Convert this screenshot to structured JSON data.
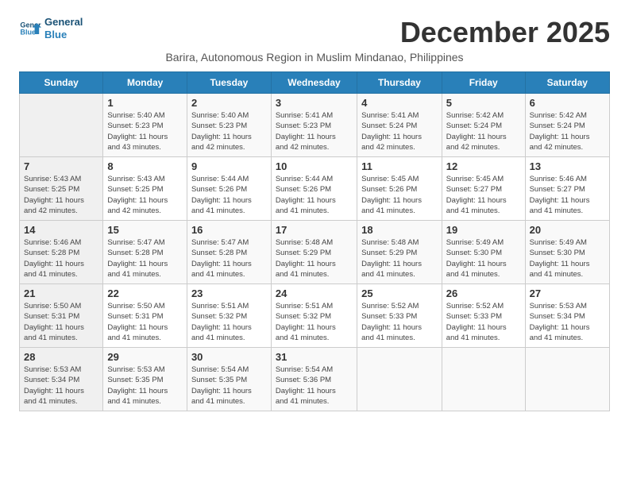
{
  "header": {
    "logo_line1": "General",
    "logo_line2": "Blue",
    "month_title": "December 2025",
    "subtitle": "Barira, Autonomous Region in Muslim Mindanao, Philippines"
  },
  "weekdays": [
    "Sunday",
    "Monday",
    "Tuesday",
    "Wednesday",
    "Thursday",
    "Friday",
    "Saturday"
  ],
  "weeks": [
    [
      {
        "day": "",
        "info": ""
      },
      {
        "day": "1",
        "info": "Sunrise: 5:40 AM\nSunset: 5:23 PM\nDaylight: 11 hours\nand 43 minutes."
      },
      {
        "day": "2",
        "info": "Sunrise: 5:40 AM\nSunset: 5:23 PM\nDaylight: 11 hours\nand 42 minutes."
      },
      {
        "day": "3",
        "info": "Sunrise: 5:41 AM\nSunset: 5:23 PM\nDaylight: 11 hours\nand 42 minutes."
      },
      {
        "day": "4",
        "info": "Sunrise: 5:41 AM\nSunset: 5:24 PM\nDaylight: 11 hours\nand 42 minutes."
      },
      {
        "day": "5",
        "info": "Sunrise: 5:42 AM\nSunset: 5:24 PM\nDaylight: 11 hours\nand 42 minutes."
      },
      {
        "day": "6",
        "info": "Sunrise: 5:42 AM\nSunset: 5:24 PM\nDaylight: 11 hours\nand 42 minutes."
      }
    ],
    [
      {
        "day": "7",
        "info": "Sunrise: 5:43 AM\nSunset: 5:25 PM\nDaylight: 11 hours\nand 42 minutes."
      },
      {
        "day": "8",
        "info": "Sunrise: 5:43 AM\nSunset: 5:25 PM\nDaylight: 11 hours\nand 42 minutes."
      },
      {
        "day": "9",
        "info": "Sunrise: 5:44 AM\nSunset: 5:26 PM\nDaylight: 11 hours\nand 41 minutes."
      },
      {
        "day": "10",
        "info": "Sunrise: 5:44 AM\nSunset: 5:26 PM\nDaylight: 11 hours\nand 41 minutes."
      },
      {
        "day": "11",
        "info": "Sunrise: 5:45 AM\nSunset: 5:26 PM\nDaylight: 11 hours\nand 41 minutes."
      },
      {
        "day": "12",
        "info": "Sunrise: 5:45 AM\nSunset: 5:27 PM\nDaylight: 11 hours\nand 41 minutes."
      },
      {
        "day": "13",
        "info": "Sunrise: 5:46 AM\nSunset: 5:27 PM\nDaylight: 11 hours\nand 41 minutes."
      }
    ],
    [
      {
        "day": "14",
        "info": "Sunrise: 5:46 AM\nSunset: 5:28 PM\nDaylight: 11 hours\nand 41 minutes."
      },
      {
        "day": "15",
        "info": "Sunrise: 5:47 AM\nSunset: 5:28 PM\nDaylight: 11 hours\nand 41 minutes."
      },
      {
        "day": "16",
        "info": "Sunrise: 5:47 AM\nSunset: 5:28 PM\nDaylight: 11 hours\nand 41 minutes."
      },
      {
        "day": "17",
        "info": "Sunrise: 5:48 AM\nSunset: 5:29 PM\nDaylight: 11 hours\nand 41 minutes."
      },
      {
        "day": "18",
        "info": "Sunrise: 5:48 AM\nSunset: 5:29 PM\nDaylight: 11 hours\nand 41 minutes."
      },
      {
        "day": "19",
        "info": "Sunrise: 5:49 AM\nSunset: 5:30 PM\nDaylight: 11 hours\nand 41 minutes."
      },
      {
        "day": "20",
        "info": "Sunrise: 5:49 AM\nSunset: 5:30 PM\nDaylight: 11 hours\nand 41 minutes."
      }
    ],
    [
      {
        "day": "21",
        "info": "Sunrise: 5:50 AM\nSunset: 5:31 PM\nDaylight: 11 hours\nand 41 minutes."
      },
      {
        "day": "22",
        "info": "Sunrise: 5:50 AM\nSunset: 5:31 PM\nDaylight: 11 hours\nand 41 minutes."
      },
      {
        "day": "23",
        "info": "Sunrise: 5:51 AM\nSunset: 5:32 PM\nDaylight: 11 hours\nand 41 minutes."
      },
      {
        "day": "24",
        "info": "Sunrise: 5:51 AM\nSunset: 5:32 PM\nDaylight: 11 hours\nand 41 minutes."
      },
      {
        "day": "25",
        "info": "Sunrise: 5:52 AM\nSunset: 5:33 PM\nDaylight: 11 hours\nand 41 minutes."
      },
      {
        "day": "26",
        "info": "Sunrise: 5:52 AM\nSunset: 5:33 PM\nDaylight: 11 hours\nand 41 minutes."
      },
      {
        "day": "27",
        "info": "Sunrise: 5:53 AM\nSunset: 5:34 PM\nDaylight: 11 hours\nand 41 minutes."
      }
    ],
    [
      {
        "day": "28",
        "info": "Sunrise: 5:53 AM\nSunset: 5:34 PM\nDaylight: 11 hours\nand 41 minutes."
      },
      {
        "day": "29",
        "info": "Sunrise: 5:53 AM\nSunset: 5:35 PM\nDaylight: 11 hours\nand 41 minutes."
      },
      {
        "day": "30",
        "info": "Sunrise: 5:54 AM\nSunset: 5:35 PM\nDaylight: 11 hours\nand 41 minutes."
      },
      {
        "day": "31",
        "info": "Sunrise: 5:54 AM\nSunset: 5:36 PM\nDaylight: 11 hours\nand 41 minutes."
      },
      {
        "day": "",
        "info": ""
      },
      {
        "day": "",
        "info": ""
      },
      {
        "day": "",
        "info": ""
      }
    ]
  ]
}
